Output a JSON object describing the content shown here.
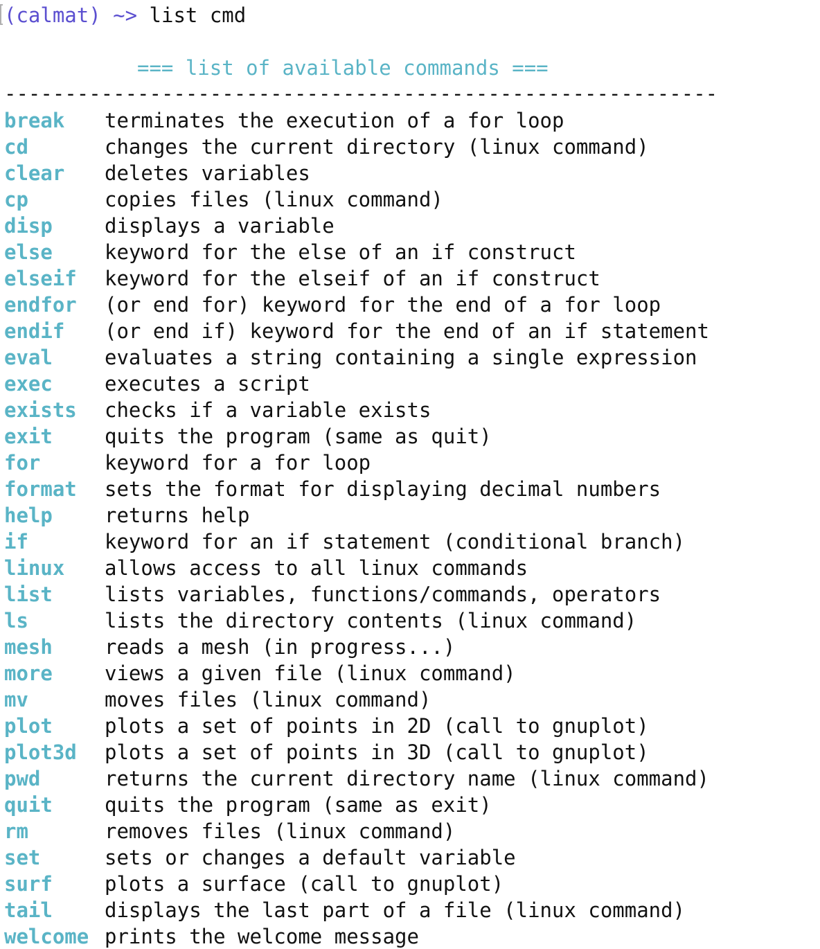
{
  "colors": {
    "prompt": "#5b4fd0",
    "command_name": "#5ab4c6",
    "text": "#111111",
    "background": "#ffffff"
  },
  "prompt": {
    "env": "(calmat)",
    "arrow": "~>",
    "command": "list cmd"
  },
  "header": "=== list of available commands ===",
  "separator": "-----------------------------------------------------------",
  "commands": [
    {
      "name": "break",
      "desc": "terminates the execution of a for loop"
    },
    {
      "name": "cd",
      "desc": "changes the current directory (linux command)"
    },
    {
      "name": "clear",
      "desc": "deletes variables"
    },
    {
      "name": "cp",
      "desc": "copies files (linux command)"
    },
    {
      "name": "disp",
      "desc": "displays a variable"
    },
    {
      "name": "else",
      "desc": "keyword for the else of an if construct"
    },
    {
      "name": "elseif",
      "desc": "keyword for the elseif of an if construct"
    },
    {
      "name": "endfor",
      "desc": "(or end for) keyword for the end of a for loop"
    },
    {
      "name": "endif",
      "desc": "(or end if) keyword for the end of an if statement"
    },
    {
      "name": "eval",
      "desc": "evaluates a string containing a single expression"
    },
    {
      "name": "exec",
      "desc": "executes a script"
    },
    {
      "name": "exists",
      "desc": "checks if a variable exists"
    },
    {
      "name": "exit",
      "desc": "quits the program (same as quit)"
    },
    {
      "name": "for",
      "desc": "keyword for a for loop"
    },
    {
      "name": "format",
      "desc": "sets the format for displaying decimal numbers"
    },
    {
      "name": "help",
      "desc": "returns help"
    },
    {
      "name": "if",
      "desc": "keyword for an if statement (conditional branch)"
    },
    {
      "name": "linux",
      "desc": "allows access to all linux commands"
    },
    {
      "name": "list",
      "desc": "lists variables, functions/commands, operators"
    },
    {
      "name": "ls",
      "desc": "lists the directory contents (linux command)"
    },
    {
      "name": "mesh",
      "desc": "reads a mesh (in progress...)"
    },
    {
      "name": "more",
      "desc": "views a given file (linux command)"
    },
    {
      "name": "mv",
      "desc": "moves files (linux command)"
    },
    {
      "name": "plot",
      "desc": "plots a set of points in 2D (call to gnuplot)"
    },
    {
      "name": "plot3d",
      "desc": "plots a set of points in 3D (call to gnuplot)"
    },
    {
      "name": "pwd",
      "desc": "returns the current directory name (linux command)"
    },
    {
      "name": "quit",
      "desc": "quits the program (same as exit)"
    },
    {
      "name": "rm",
      "desc": "removes files (linux command)"
    },
    {
      "name": "set",
      "desc": "sets or changes a default variable"
    },
    {
      "name": "surf",
      "desc": "plots a surface (call to gnuplot)"
    },
    {
      "name": "tail",
      "desc": "displays the last part of a file (linux command)"
    },
    {
      "name": "welcome",
      "desc": "prints the welcome message"
    }
  ]
}
